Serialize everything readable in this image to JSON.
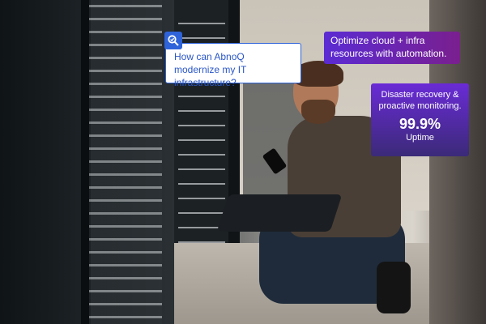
{
  "question": {
    "text": "How can AbnoQ modernize my IT infrastructure?"
  },
  "search_icon": {
    "name": "search-icon"
  },
  "optimize": {
    "text": "Optimize cloud + infra resources with automation."
  },
  "recovery": {
    "text": "Disaster recovery & proactive monitoring.",
    "value": "99.9%",
    "label": "Uptime"
  },
  "colors": {
    "accent_blue": "#2e63d9",
    "gradient_start": "#5b2bd3",
    "gradient_end": "#7a1f8f"
  }
}
